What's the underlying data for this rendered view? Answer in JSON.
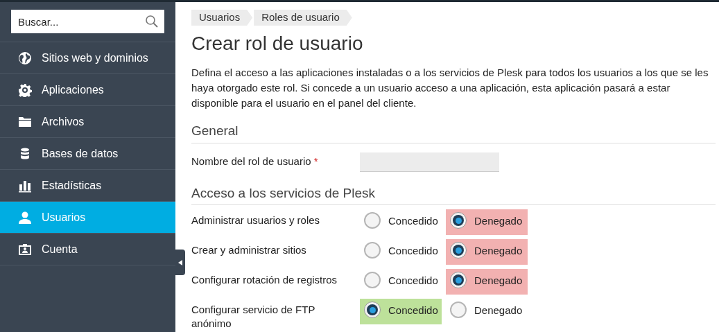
{
  "sidebar": {
    "search": {
      "placeholder": "Buscar..."
    },
    "items": [
      {
        "label": "Sitios web y dominios",
        "selected": false
      },
      {
        "label": "Aplicaciones",
        "selected": false
      },
      {
        "label": "Archivos",
        "selected": false
      },
      {
        "label": "Bases de datos",
        "selected": false
      },
      {
        "label": "Estadísticas",
        "selected": false
      },
      {
        "label": "Usuarios",
        "selected": true
      },
      {
        "label": "Cuenta",
        "selected": false
      }
    ]
  },
  "breadcrumbs": [
    "Usuarios",
    "Roles de usuario"
  ],
  "title": "Crear rol de usuario",
  "description": "Defina el acceso a las aplicaciones instaladas o a los servicios de Plesk para todos los usuarios a los que se les haya otorgado este rol. Si concede a un usuario acceso a una aplicación, esta aplicación pasará a estar disponible para el usuario en el panel del cliente.",
  "general": {
    "heading": "General",
    "field": {
      "label": "Nombre del rol de usuario",
      "required_mark": "*"
    }
  },
  "services": {
    "heading": "Acceso a los servicios de Plesk",
    "rows": [
      {
        "label": "Administrar usuarios y roles",
        "options": [
          {
            "label": "Concedido",
            "selected": false
          },
          {
            "label": "Denegado",
            "selected": true
          }
        ]
      },
      {
        "label": "Crear y administrar sitios",
        "options": [
          {
            "label": "Concedido",
            "selected": false
          },
          {
            "label": "Denegado",
            "selected": true
          }
        ]
      },
      {
        "label": "Configurar rotación de registros",
        "options": [
          {
            "label": "Concedido",
            "selected": false
          },
          {
            "label": "Denegado",
            "selected": true
          }
        ]
      },
      {
        "label": "Configurar servicio de FTP anónimo",
        "options": [
          {
            "label": "Concedido",
            "selected": true
          },
          {
            "label": "Denegado",
            "selected": false
          }
        ]
      }
    ]
  }
}
